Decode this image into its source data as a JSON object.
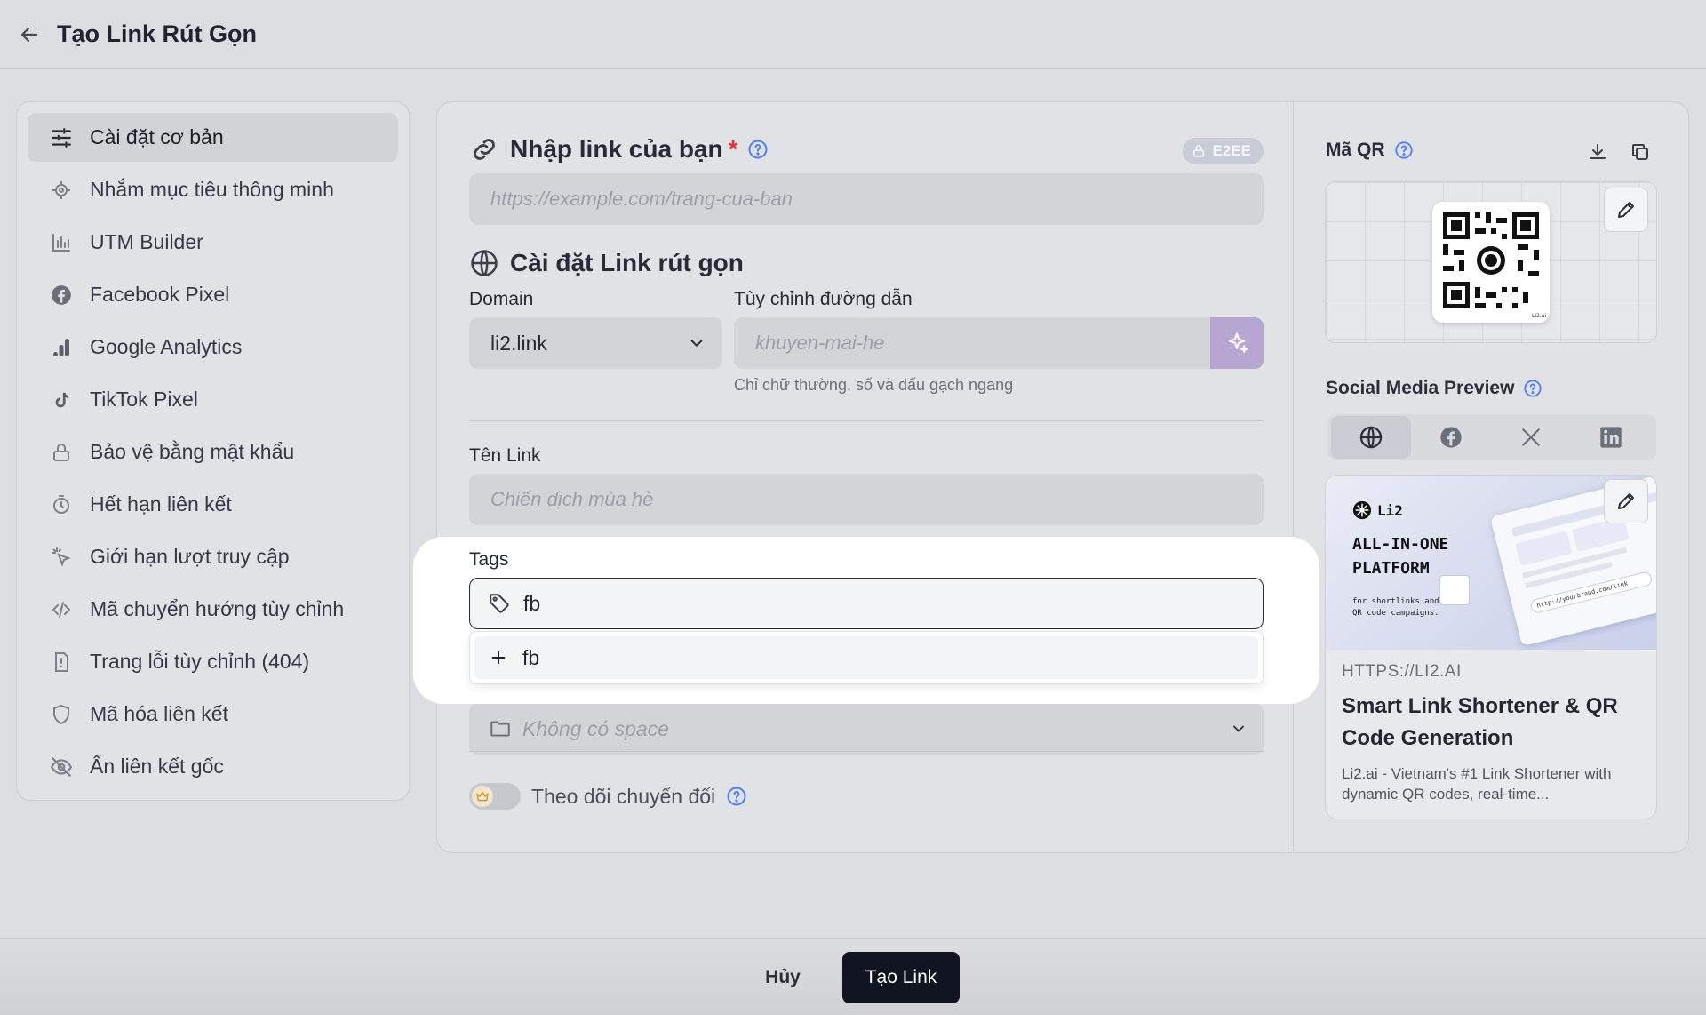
{
  "header": {
    "title": "Tạo Link Rút Gọn"
  },
  "sidebar": {
    "items": [
      {
        "label": "Cài đặt cơ bản",
        "icon": "sliders-icon"
      },
      {
        "label": "Nhắm mục tiêu thông minh",
        "icon": "target-icon"
      },
      {
        "label": "UTM Builder",
        "icon": "bar-chart-icon"
      },
      {
        "label": "Facebook Pixel",
        "icon": "facebook-icon"
      },
      {
        "label": "Google Analytics",
        "icon": "analytics-icon"
      },
      {
        "label": "TikTok Pixel",
        "icon": "tiktok-icon"
      },
      {
        "label": "Bảo vệ bằng mật khẩu",
        "icon": "lock-icon"
      },
      {
        "label": "Hết hạn liên kết",
        "icon": "timer-icon"
      },
      {
        "label": "Giới hạn lượt truy cập",
        "icon": "click-icon"
      },
      {
        "label": "Mã chuyển hướng tùy chỉnh",
        "icon": "code-icon"
      },
      {
        "label": "Trang lỗi tùy chỉnh (404)",
        "icon": "file-alert-icon"
      },
      {
        "label": "Mã hóa liên kết",
        "icon": "shield-icon"
      },
      {
        "label": "Ẩn liên kết gốc",
        "icon": "eye-off-icon"
      }
    ]
  },
  "form": {
    "url_section": {
      "title": "Nhập link của bạn",
      "required_mark": "*",
      "badge": "E2EE",
      "placeholder": "https://example.com/trang-cua-ban"
    },
    "short_section": {
      "title": "Cài đặt Link rút gọn"
    },
    "domain": {
      "label": "Domain",
      "value": "li2.link"
    },
    "custom_path": {
      "label": "Tùy chỉnh đường dẫn",
      "placeholder": "khuyen-mai-he",
      "hint": "Chỉ chữ thường, số và dấu gạch ngang"
    },
    "link_name": {
      "label": "Tên Link",
      "placeholder": "Chiến dịch mùa hè"
    },
    "tags": {
      "label": "Tags",
      "value": "fb",
      "suggestion": "fb"
    },
    "space": {
      "placeholder": "Không có space"
    },
    "conversion": {
      "label": "Theo dõi chuyển đổi",
      "enabled": false
    }
  },
  "qr": {
    "title": "Mã QR",
    "brand_small": "Li2.ai"
  },
  "social": {
    "title": "Social Media Preview",
    "tabs": [
      "globe-icon",
      "facebook-icon",
      "x-icon",
      "linkedin-icon"
    ],
    "active_tab": 0,
    "preview": {
      "image_brand": "Li2",
      "image_headline_1": "ALL-IN-ONE",
      "image_headline_2": "PLATFORM",
      "image_tagline_1": "for shortlinks and",
      "image_tagline_2": "QR code campaigns.",
      "image_url_chip": "http://yourbrand.com/link",
      "domain": "HTTPS://LI2.AI",
      "title": "Smart Link Shortener & QR Code Generation",
      "description": "Li2.ai - Vietnam's #1 Link Shortener with dynamic QR codes, real-time..."
    }
  },
  "footer": {
    "cancel": "Hủy",
    "create": "Tạo Link"
  },
  "colors": {
    "accent": "#4f7cf7",
    "primary_button": "#101521",
    "magic_button": "#b7a6d2"
  }
}
